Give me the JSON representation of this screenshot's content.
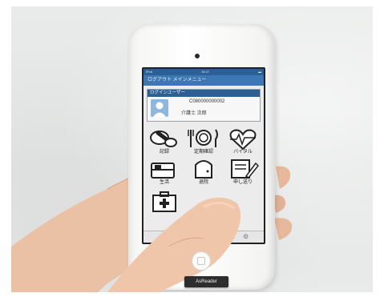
{
  "phone": {
    "statusbar": {
      "left": "iPod",
      "time": "15:47",
      "right": ""
    },
    "app_title": "ログアウト メインメニュー",
    "login": {
      "header": "ログインユーザー",
      "user_id": "C080000000002",
      "user_name": "介護士 次郎"
    },
    "menu_tiles": [
      {
        "label": "記録",
        "icon": "medication-icon"
      },
      {
        "label": "定期確認",
        "icon": "meal-icon"
      },
      {
        "label": "バイタル",
        "icon": "vital-heart-icon"
      },
      {
        "label": "生活",
        "icon": "bed-icon"
      },
      {
        "label": "退院",
        "icon": "door-icon"
      },
      {
        "label": "申し送り",
        "icon": "note-icon"
      },
      {
        "label": "",
        "icon": "medical-kit-icon"
      }
    ],
    "brand": "AsReader"
  },
  "colors": {
    "accent": "#3d77b4",
    "statusbar": "#2b5f98",
    "case": "#f7f7f5"
  }
}
